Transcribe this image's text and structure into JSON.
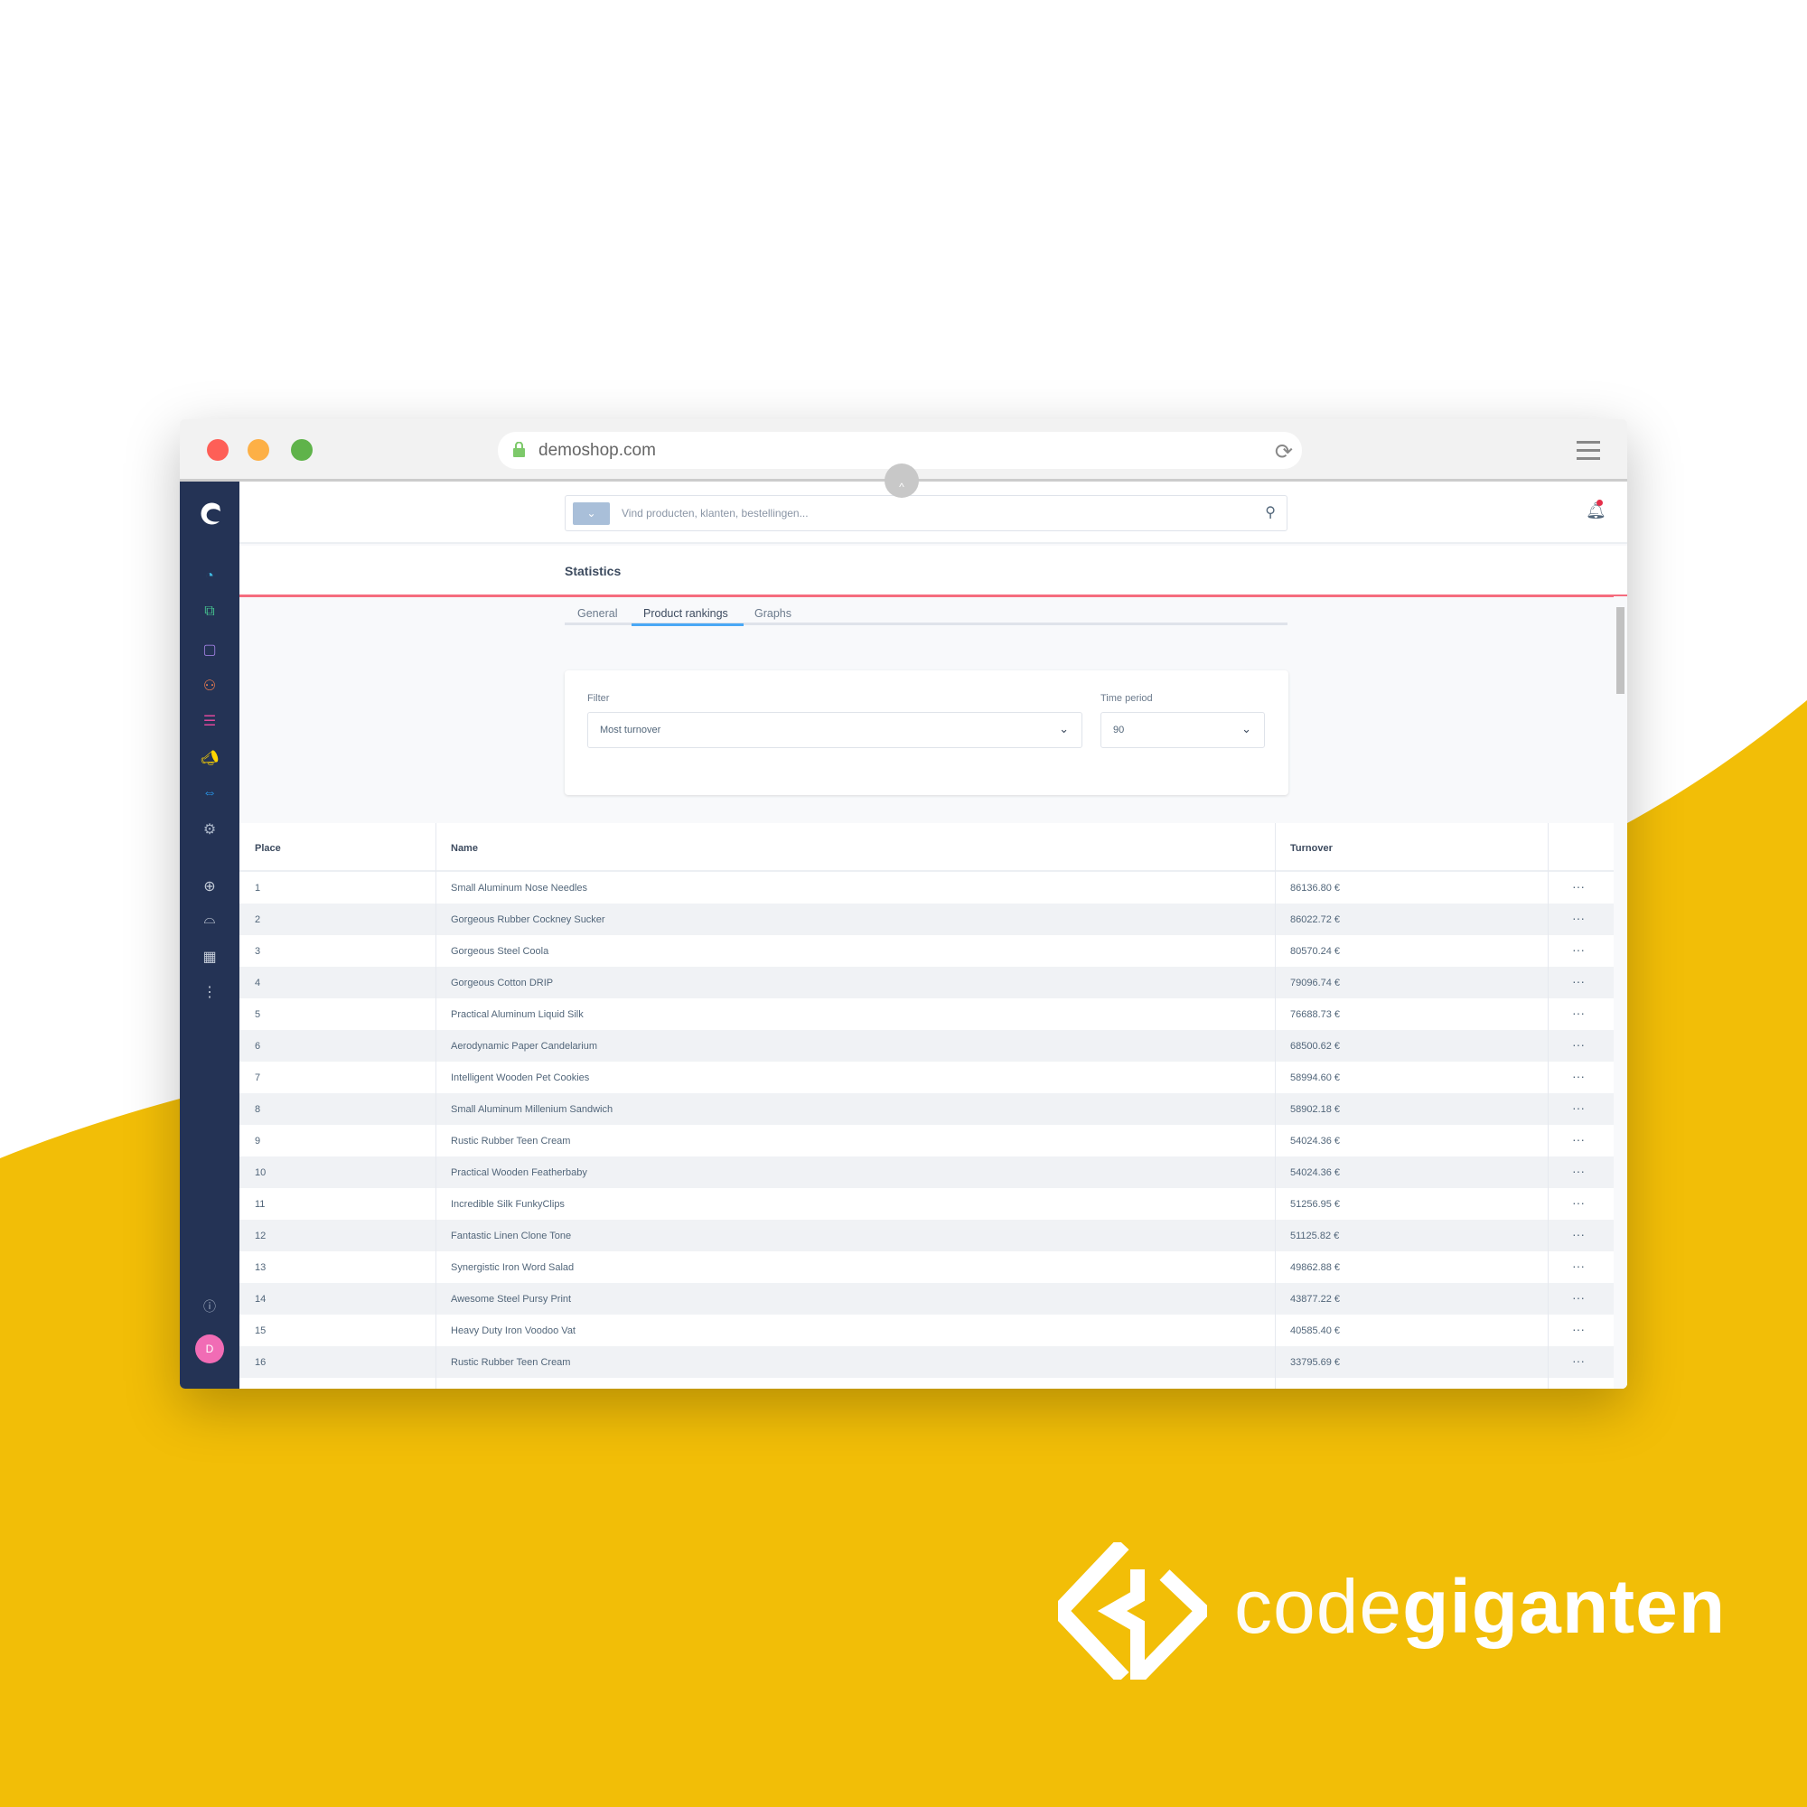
{
  "browser": {
    "url": "demoshop.com",
    "colors": {
      "close": "#fe5f57",
      "minimize": "#fdb046",
      "maximize": "#5fb34a"
    }
  },
  "background": {
    "accent": "#F2BE07"
  },
  "sidebar": {
    "items": [
      {
        "icon": "dashboard-icon",
        "color": "#3fb8e0"
      },
      {
        "icon": "catalogues-icon",
        "color": "#45c38e"
      },
      {
        "icon": "orders-icon",
        "color": "#9b7ddb"
      },
      {
        "icon": "customers-icon",
        "color": "#f07d4f"
      },
      {
        "icon": "content-icon",
        "color": "#e0489c"
      },
      {
        "icon": "marketing-icon",
        "color": "#ffd500"
      },
      {
        "icon": "extensions-icon",
        "color": "#289cf2"
      },
      {
        "icon": "settings-icon",
        "color": "#a8b4c6"
      },
      {
        "icon": "add-icon",
        "color": "#c4ccd8"
      },
      {
        "icon": "sales-channel-icon",
        "color": "#c4ccd8"
      },
      {
        "icon": "storefront-icon",
        "color": "#c4ccd8"
      },
      {
        "icon": "more-icon",
        "color": "#c4ccd8"
      }
    ],
    "help_icon": "help-icon",
    "avatar_initial": "D",
    "avatar_color": "#f16cb5"
  },
  "search": {
    "placeholder": "Vind producten, klanten, bestellingen..."
  },
  "page": {
    "title": "Statistics"
  },
  "tabs": [
    {
      "label": "General"
    },
    {
      "label": "Product rankings",
      "active": true
    },
    {
      "label": "Graphs"
    }
  ],
  "filters": {
    "filter_label": "Filter",
    "filter_value": "Most turnover",
    "period_label": "Time period",
    "period_value": "90"
  },
  "table": {
    "headers": {
      "place": "Place",
      "name": "Name",
      "turnover": "Turnover"
    },
    "rows": [
      [
        "1",
        "Small Aluminum Nose Needles",
        "86136.80 €"
      ],
      [
        "2",
        "Gorgeous Rubber Cockney Sucker",
        "86022.72 €"
      ],
      [
        "3",
        "Gorgeous Steel Coola",
        "80570.24 €"
      ],
      [
        "4",
        "Gorgeous Cotton DRIP",
        "79096.74 €"
      ],
      [
        "5",
        "Practical Aluminum Liquid Silk",
        "76688.73 €"
      ],
      [
        "6",
        "Aerodynamic Paper Candelarium",
        "68500.62 €"
      ],
      [
        "7",
        "Intelligent Wooden Pet Cookies",
        "58994.60 €"
      ],
      [
        "8",
        "Small Aluminum Millenium Sandwich",
        "58902.18 €"
      ],
      [
        "9",
        "Rustic Rubber Teen Cream",
        "54024.36 €"
      ],
      [
        "10",
        "Practical Wooden Featherbaby",
        "54024.36 €"
      ],
      [
        "11",
        "Incredible Silk FunkyClips",
        "51256.95 €"
      ],
      [
        "12",
        "Fantastic Linen Clone Tone",
        "51125.82 €"
      ],
      [
        "13",
        "Synergistic Iron Word Salad",
        "49862.88 €"
      ],
      [
        "14",
        "Awesome Steel Pursy Print",
        "43877.22 €"
      ],
      [
        "15",
        "Heavy Duty Iron Voodoo Vat",
        "40585.40 €"
      ],
      [
        "16",
        "Rustic Rubber Teen Cream",
        "33795.69 €"
      ]
    ],
    "row_action": "···"
  },
  "branding": {
    "light": "code",
    "bold": "giganten"
  }
}
